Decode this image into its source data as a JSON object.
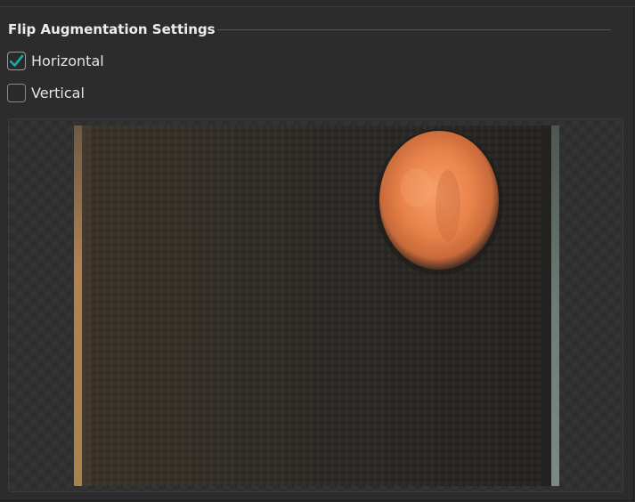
{
  "group": {
    "title": "Flip Augmentation Settings"
  },
  "options": {
    "horizontal": {
      "label": "Horizontal",
      "checked": true
    },
    "vertical": {
      "label": "Vertical",
      "checked": false
    }
  },
  "colors": {
    "background": "#2c2c2c",
    "checkmark": "#1aa9a3",
    "checkbox_border": "#8a8a8a",
    "orb": "#e07a3c",
    "left_strip": "#9a7040",
    "right_strip": "#6f7f78"
  },
  "icons": {
    "check": "check-icon"
  }
}
